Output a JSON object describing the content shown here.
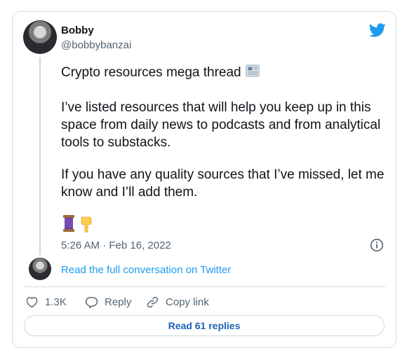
{
  "author": {
    "name": "Bobby",
    "handle": "@bobbybanzai"
  },
  "tweet": {
    "line1": "Crypto resources mega thread",
    "para2": "I’ve listed resources that will help you keep up in this space from daily news to podcasts and from analytical tools to substacks.",
    "para3": "If you have any quality sources that I’ve missed, let me know and I’ll add them.",
    "emoji_icons": [
      "thread-spool-icon",
      "pointing-down-hand-icon",
      "newspaper-icon"
    ],
    "timestamp": "5:26 AM · Feb 16, 2022"
  },
  "conversation_link": "Read the full conversation on Twitter",
  "actions": {
    "likes": "1.3K",
    "reply": "Reply",
    "copy_link": "Copy link"
  },
  "read_replies": "Read 61 replies",
  "colors": {
    "brand": "#1d9bf0",
    "text": "#0f1419",
    "muted": "#536471",
    "border": "#cfd9de"
  }
}
